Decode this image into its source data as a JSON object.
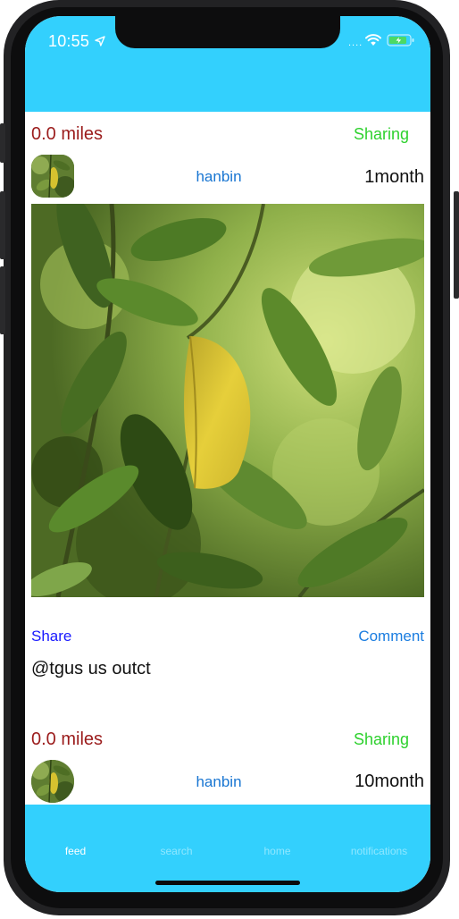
{
  "status_bar": {
    "time": "10:55",
    "location_icon": "location-arrow-icon",
    "wifi_icon": "wifi-icon",
    "battery_icon": "battery-charging-icon",
    "signal": "...."
  },
  "colors": {
    "accent": "#33d0fd",
    "miles": "#9b1c1c",
    "sharing": "#2ed12e",
    "username": "#1976d2",
    "share": "#1a1aff",
    "comment": "#1b7de0"
  },
  "posts": [
    {
      "distance": "0.0 miles",
      "status": "Sharing",
      "username": "hanbin",
      "age": "1month",
      "share_label": "Share",
      "comment_label": "Comment",
      "caption": "@tgus us outct"
    },
    {
      "distance": "0.0 miles",
      "status": "Sharing",
      "username": "hanbin",
      "age": "10month"
    }
  ],
  "tabs": [
    {
      "label": "feed",
      "active": true
    },
    {
      "label": "search",
      "active": false
    },
    {
      "label": "home",
      "active": false
    },
    {
      "label": "notifications",
      "active": false
    }
  ]
}
